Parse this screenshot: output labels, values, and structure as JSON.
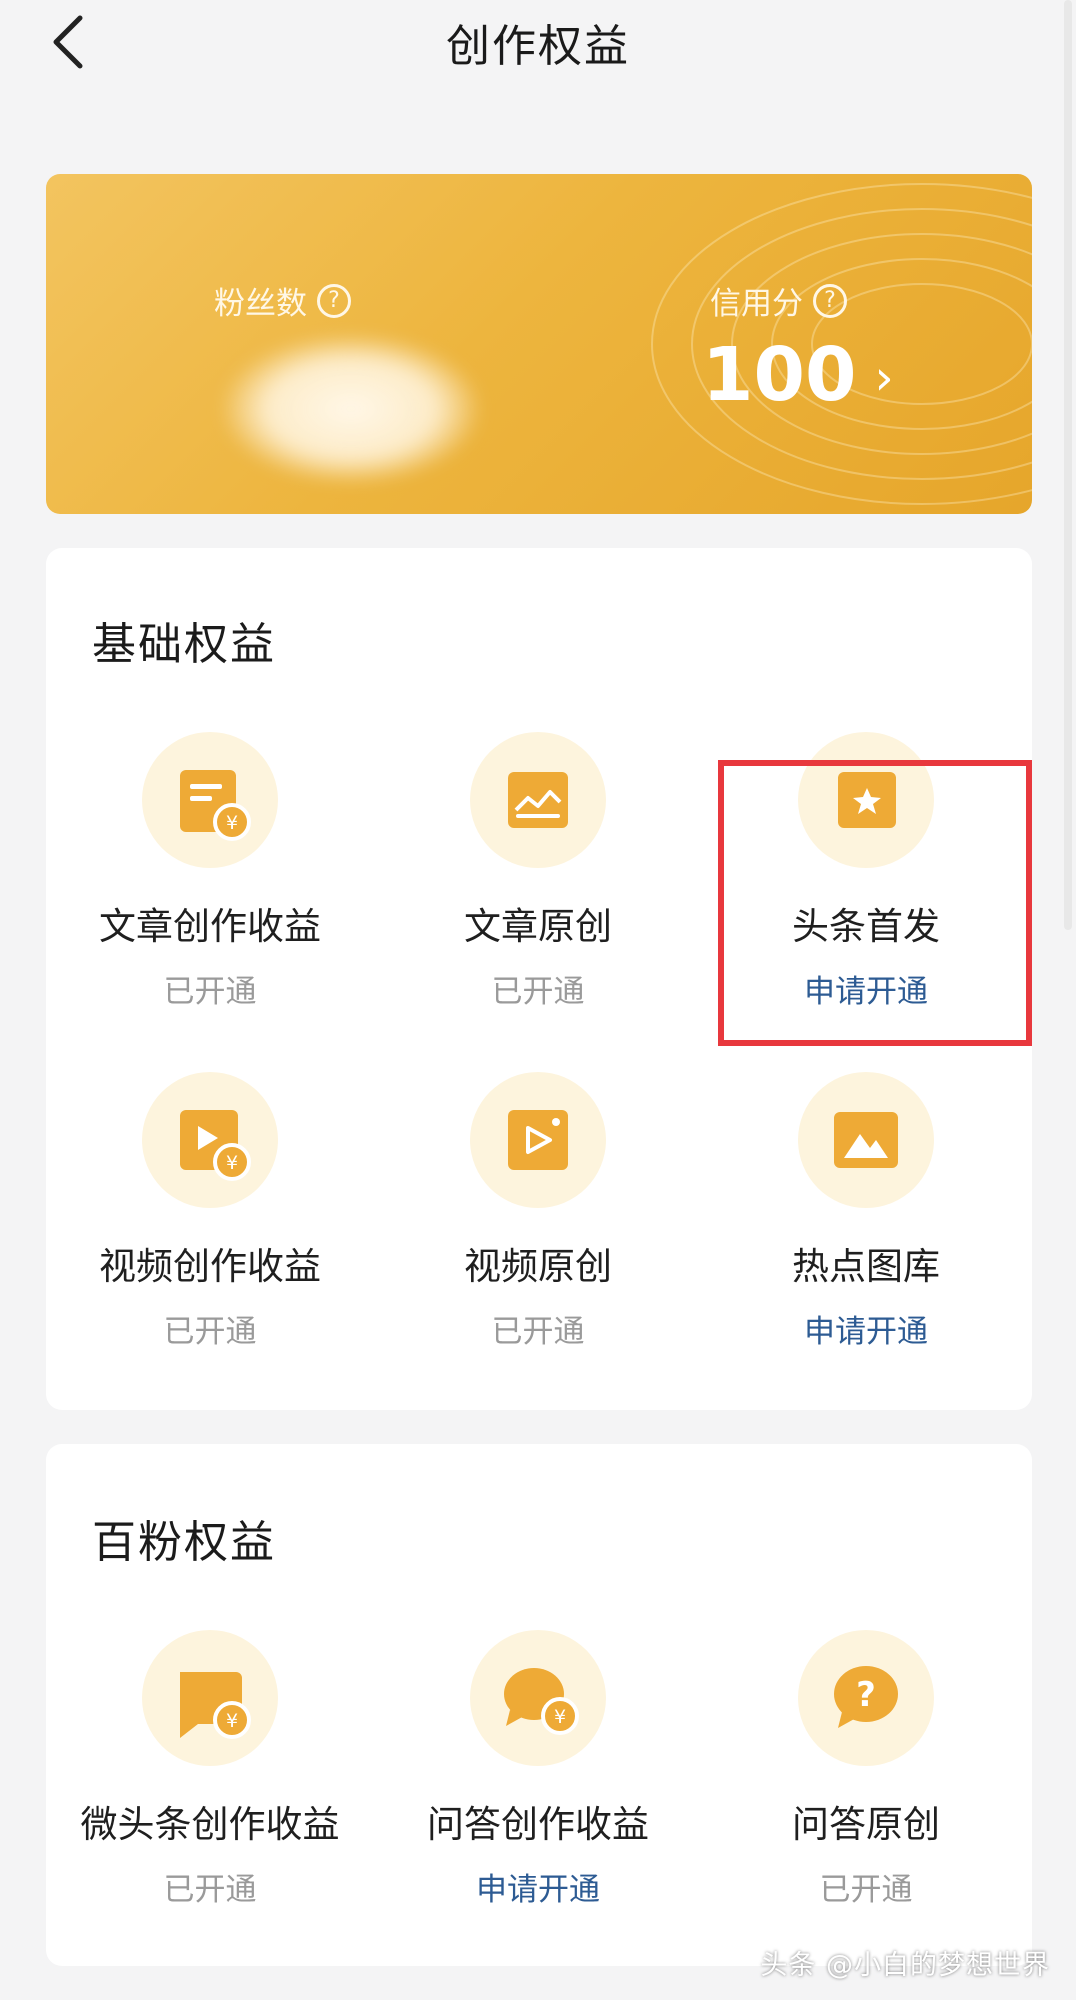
{
  "header": {
    "title": "创作权益",
    "back_label": "返回"
  },
  "stats": {
    "fans_label": "粉丝数",
    "credit_label": "信用分",
    "credit_value": "100",
    "question_icon": "?",
    "chevron": "›"
  },
  "basic": {
    "title": "基础权益",
    "items": [
      {
        "name": "文章创作收益",
        "status": "已开通",
        "icon": "article-income-icon"
      },
      {
        "name": "文章原创",
        "status": "已开通",
        "icon": "image-frame-icon"
      },
      {
        "name": "头条首发",
        "status": "申请开通",
        "icon": "star-bookmark-icon"
      },
      {
        "name": "视频创作收益",
        "status": "已开通",
        "icon": "video-income-icon"
      },
      {
        "name": "视频原创",
        "status": "已开通",
        "icon": "video-play-icon"
      },
      {
        "name": "热点图库",
        "status": "申请开通",
        "icon": "mountain-image-icon"
      }
    ]
  },
  "hundred": {
    "title": "百粉权益",
    "items": [
      {
        "name": "微头条创作收益",
        "status": "已开通",
        "icon": "micro-post-income-icon"
      },
      {
        "name": "问答创作收益",
        "status": "申请开通",
        "icon": "qa-income-icon"
      },
      {
        "name": "问答原创",
        "status": "已开通",
        "icon": "question-bubble-icon"
      }
    ]
  },
  "watermark": "头条 @小白的梦想世界",
  "colors": {
    "gold": "#edb53e",
    "apply_blue": "#2d5b93",
    "highlight_red": "#e8383d",
    "icon_bg": "#fdf4dd"
  }
}
